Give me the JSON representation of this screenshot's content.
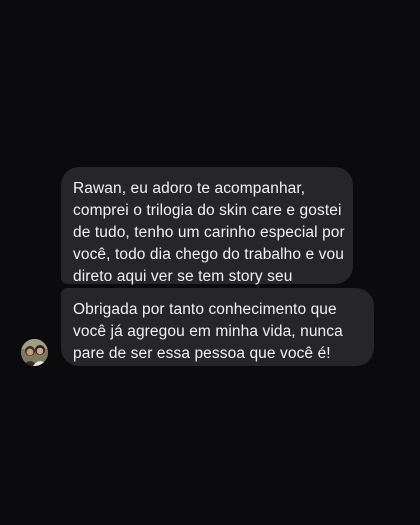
{
  "conversation": {
    "messages": [
      {
        "lines": [
          "Rawan, eu adoro te acompanhar,",
          "comprei o trilogia do skin care e gostei",
          "de tudo, tenho um carinho especial por",
          "você, todo dia chego do trabalho e vou",
          "direto aqui ver se tem story seu"
        ]
      },
      {
        "lines": [
          "Obrigada por tanto conhecimento que",
          "você já agregou em minha vida, nunca",
          "pare de ser essa pessoa que você é!"
        ]
      }
    ]
  },
  "colors": {
    "background": "#0b0b0d",
    "bubble": "#26262a",
    "text": "#f2f2f2"
  },
  "icons": {
    "avatar": "user-avatar-photo"
  }
}
